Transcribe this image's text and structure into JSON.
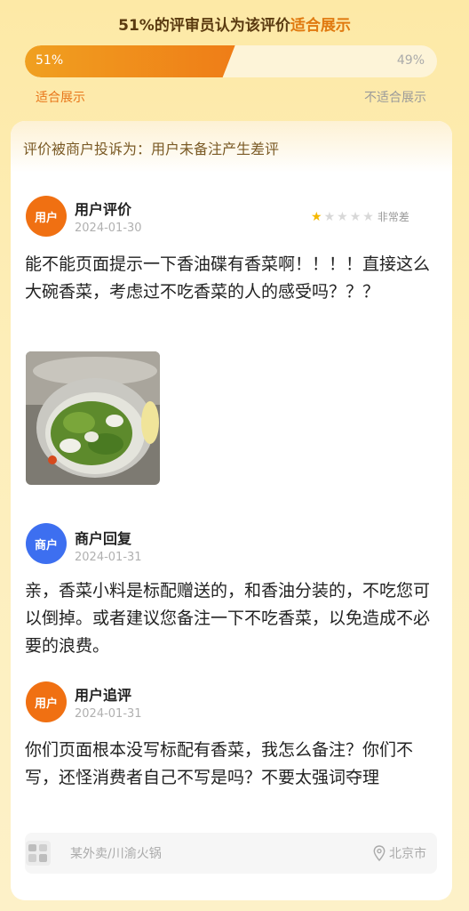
{
  "vote": {
    "percent_label": "51%",
    "title_mid": "的评审员认为该评价",
    "title_highlight": "适合展示",
    "agree_percent": 51,
    "agree_label": "51%",
    "disagree_label": "49%",
    "left_label": "适合展示",
    "right_label": "不适合展示"
  },
  "card": {
    "complaint": "评价被商户投诉为：用户未备注产生差评"
  },
  "review": {
    "avatar_text": "用户",
    "title": "用户评价",
    "date": "2024-01-30",
    "rating": 1,
    "rating_max": 5,
    "rating_label": "非常差",
    "text": "能不能页面提示一下香油碟有香菜啊！！！！直接这么大碗香菜，考虑过不吃香菜的人的感受吗？？？"
  },
  "reply": {
    "avatar_text": "商户",
    "title": "商户回复",
    "date": "2024-01-31",
    "text": "亲，香菜小料是标配赠送的，和香油分装的，不吃您可以倒掉。或者建议您备注一下不吃香菜，以免造成不必要的浪费。"
  },
  "followup": {
    "avatar_text": "用户",
    "title": "用户追评",
    "date": "2024-01-31",
    "text": "你们页面根本没写标配有香菜，我怎么备注？你们不写，还怪消费者自己不写是吗？不要太强词夺理"
  },
  "footer": {
    "store": "某外卖/川渝火锅",
    "location": "北京市"
  },
  "colors": {
    "accent": "#ef7d17",
    "user_avatar": "#f07012",
    "merchant_avatar": "#3d6ff0",
    "star": "#f5b800"
  }
}
